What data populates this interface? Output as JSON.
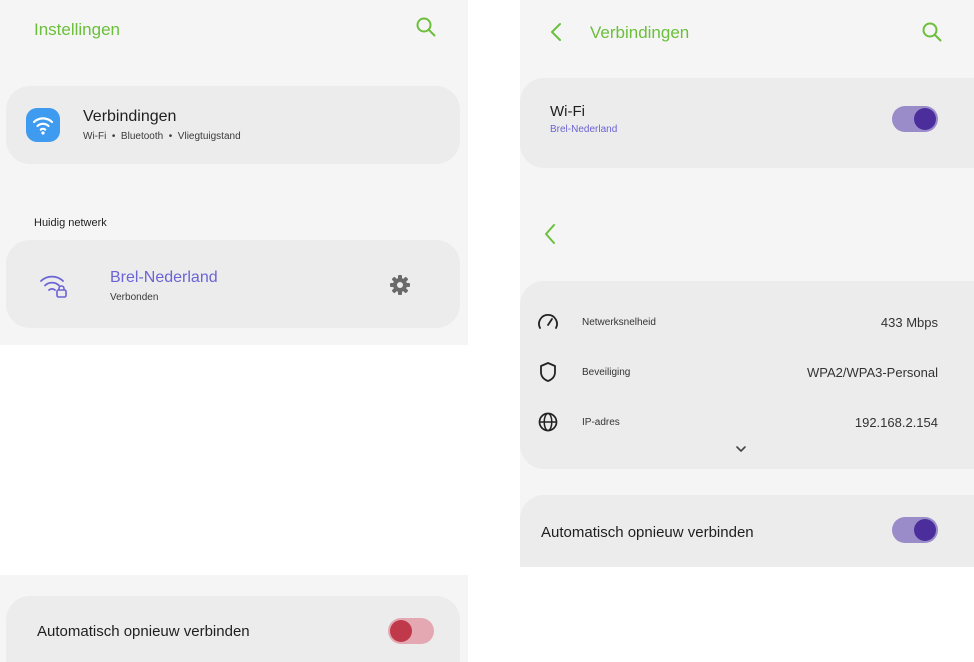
{
  "left": {
    "header": {
      "title": "Instellingen"
    },
    "connections_card": {
      "title": "Verbindingen",
      "subtitle": "Wi-Fi  •  Bluetooth  •  Vliegtuigstand"
    },
    "current_network": {
      "section_label": "Huidig netwerk",
      "name": "Brel-Nederland",
      "status": "Verbonden"
    },
    "auto_reconnect": {
      "label": "Automatisch opnieuw verbinden",
      "enabled": true,
      "color": "#c0394a"
    }
  },
  "right": {
    "header": {
      "title": "Verbindingen"
    },
    "wifi_card": {
      "title": "Wi-Fi",
      "network": "Brel-Nederland",
      "enabled": true
    },
    "details": {
      "rows": [
        {
          "icon": "speed-gauge-icon",
          "label": "Netwerksnelheid",
          "value": "433 Mbps"
        },
        {
          "icon": "shield-icon",
          "label": "Beveiliging",
          "value": "WPA2/WPA3-Personal"
        },
        {
          "icon": "globe-icon",
          "label": "IP-adres",
          "value": "192.168.2.154"
        }
      ]
    },
    "auto_reconnect": {
      "label": "Automatisch opnieuw verbinden",
      "enabled": true,
      "color": "#4b2e9b"
    }
  },
  "colors": {
    "accent_green": "#6bbf3a",
    "network_purple": "#6b63d6",
    "toggle_purple": "#4b2e9b",
    "toggle_red": "#c0394a"
  }
}
